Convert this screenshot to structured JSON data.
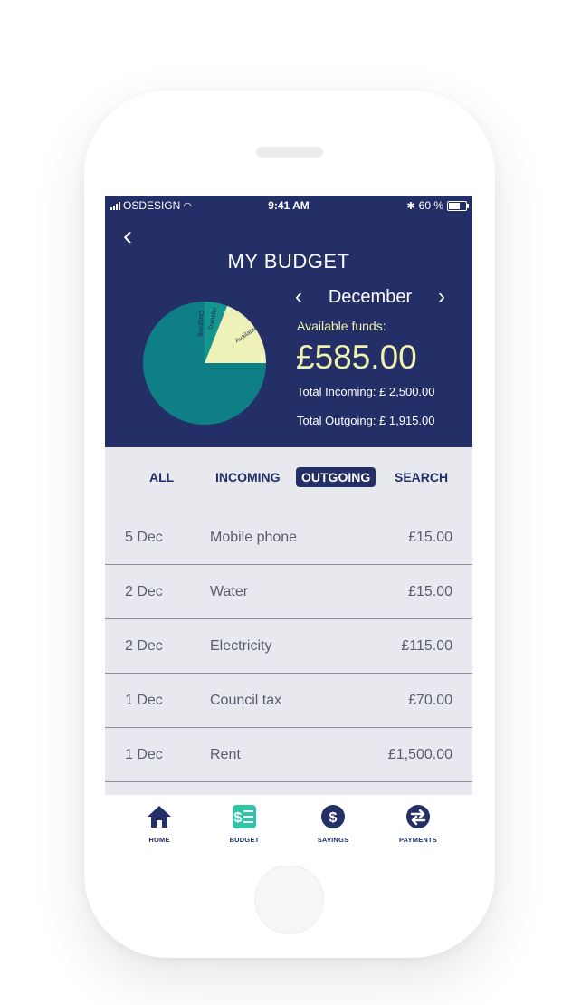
{
  "status_bar": {
    "carrier": "OSDESIGN",
    "time": "9:41 AM",
    "battery": "60 %"
  },
  "header": {
    "title": "MY BUDGET",
    "month": "December",
    "funds_label": "Available funds:",
    "funds_amount": "£585.00",
    "total_incoming": "Total Incoming: £ 2,500.00",
    "total_outgoing": "Total Outgoing: £ 1,915.00"
  },
  "chart_data": {
    "type": "pie",
    "labels": [
      "Outgoing",
      "Transfer",
      "Available"
    ],
    "values": [
      75,
      6,
      19
    ],
    "colors": [
      "#0f7f86",
      "#14958e",
      "#eef1b8"
    ]
  },
  "filters": {
    "all": "ALL",
    "incoming": "INCOMING",
    "outgoing": "OUTGOING",
    "search": "SEARCH",
    "active": "OUTGOING"
  },
  "transactions": [
    {
      "date": "5 Dec",
      "name": "Mobile phone",
      "amount": "£15.00"
    },
    {
      "date": "2 Dec",
      "name": "Water",
      "amount": "£15.00"
    },
    {
      "date": "2 Dec",
      "name": "Electricity",
      "amount": "£115.00"
    },
    {
      "date": "1 Dec",
      "name": "Council tax",
      "amount": "£70.00"
    },
    {
      "date": "1 Dec",
      "name": "Rent",
      "amount": "£1,500.00"
    }
  ],
  "tabbar": {
    "home": "HOME",
    "budget": "BUDGET",
    "savings": "SAVINGS",
    "payments": "PAYMENTS",
    "active": "BUDGET"
  },
  "colors": {
    "navy": "#232f66",
    "accent": "#2ec4a6",
    "cream": "#eef1b0",
    "list_bg": "#e8e9ef"
  }
}
